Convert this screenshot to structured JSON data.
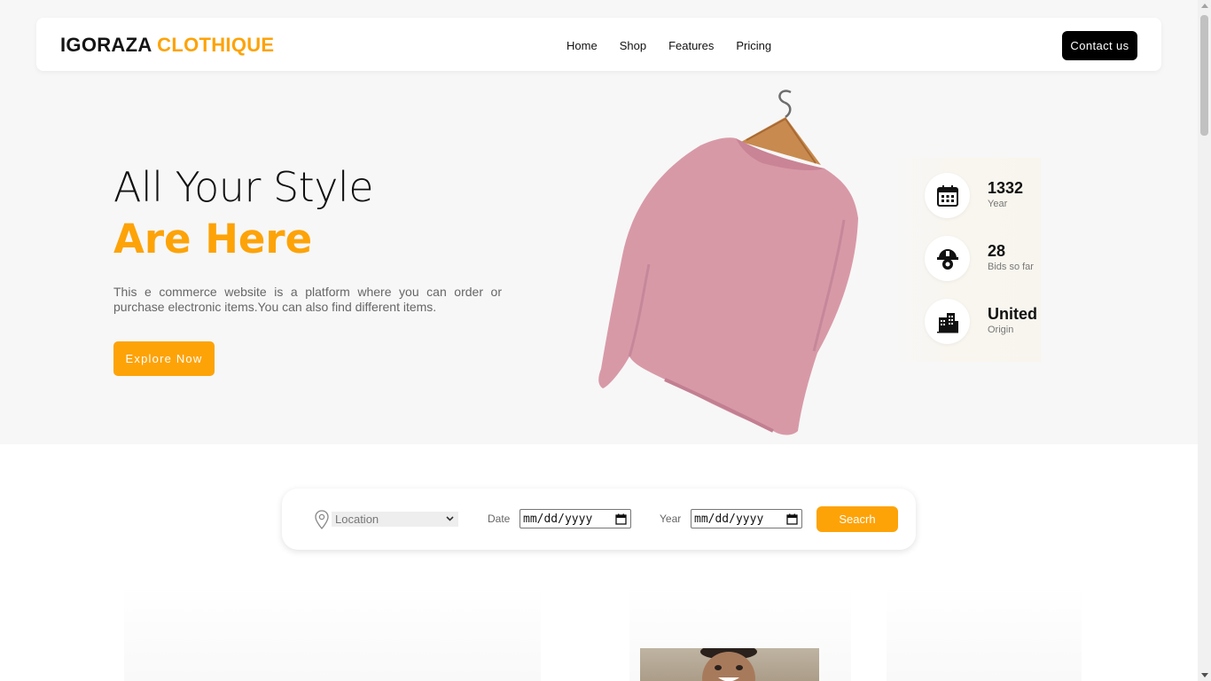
{
  "brand": {
    "part1": "IGORAZA",
    "part2": "CLOTHIQUE"
  },
  "nav": {
    "items": [
      {
        "label": "Home"
      },
      {
        "label": "Shop"
      },
      {
        "label": "Features"
      },
      {
        "label": "Pricing"
      }
    ],
    "contact_label": "Contact us"
  },
  "hero": {
    "title_line1": "All Your Style",
    "title_line2": "Are Here",
    "description": "This e commerce website is a platform where you can order or purchase electronic items.You can also find different items.",
    "cta_label": "Explore Now"
  },
  "stats": [
    {
      "value": "1332",
      "label": "Year",
      "icon": "calendar-icon"
    },
    {
      "value": "28",
      "label": "Bids so far",
      "icon": "hardhat-gear-icon"
    },
    {
      "value": "United",
      "label": "Origin",
      "icon": "buildings-icon"
    }
  ],
  "search": {
    "location_placeholder": "Location",
    "date_label": "Date",
    "date_value": "mm/dd/yyyy",
    "year_label": "Year",
    "year_value": "mm/dd/yyyy",
    "button_label": "Seacrh"
  },
  "colors": {
    "accent": "#fda308",
    "dark": "#000000",
    "hero_bg": "#f7f7f7"
  }
}
